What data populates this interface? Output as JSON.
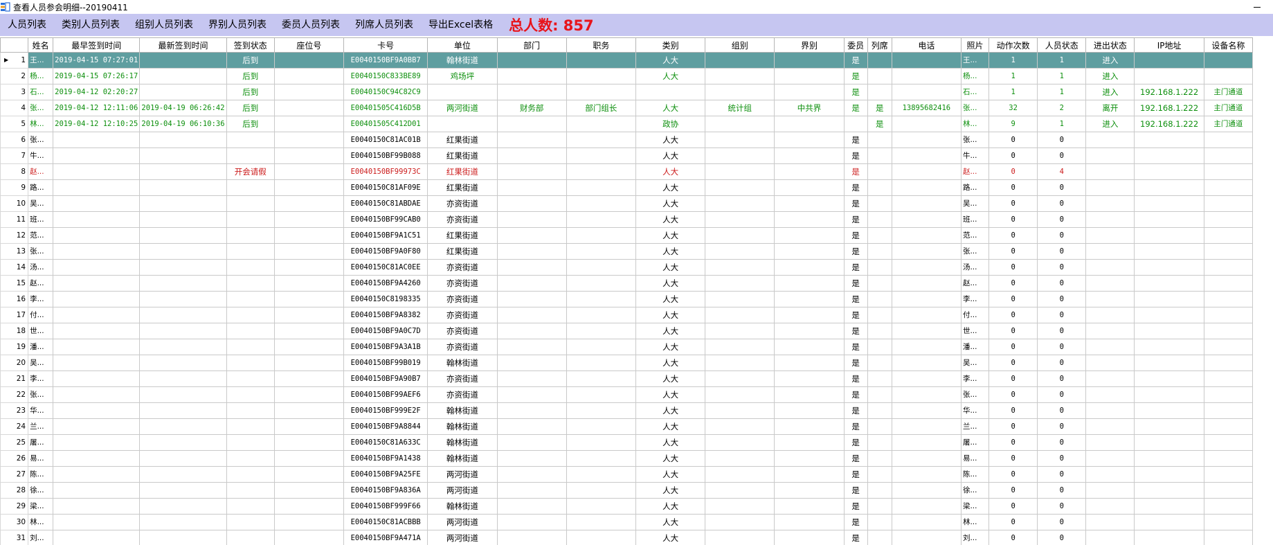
{
  "window": {
    "title": "查看人员参会明细--20190411",
    "app_icon": "app-icon",
    "minimize_label": "–"
  },
  "menu": {
    "items": [
      "人员列表",
      "类别人员列表",
      "组别人员列表",
      "界别人员列表",
      "委员人员列表",
      "列席人员列表",
      "导出Excel表格"
    ],
    "total_label": "总人数: 857"
  },
  "colors": {
    "menubar": "#c6c6f1",
    "selected_row": "#5f9ea0",
    "green_text": "#0d8f0d",
    "red_text": "#cc1c1c",
    "total_text": "#e8141b"
  },
  "columns": [
    "姓名",
    "最早签到时间",
    "最新签到时间",
    "签到状态",
    "座位号",
    "卡号",
    "单位",
    "部门",
    "职务",
    "类别",
    "组别",
    "界别",
    "委员",
    "列席",
    "电话",
    "照片",
    "动作次数",
    "人员状态",
    "进出状态",
    "IP地址",
    "设备名称"
  ],
  "rows": [
    {
      "n": "1",
      "style": "sel",
      "c": [
        "王...",
        "2019-04-15 07:27:01",
        "",
        "后到",
        "",
        "E0040150BF9A0BB7",
        "翰林街道",
        "",
        "",
        "人大",
        "",
        "",
        "是",
        "",
        "",
        "王...",
        "1",
        "1",
        "进入",
        "",
        ""
      ]
    },
    {
      "n": "2",
      "style": "green",
      "c": [
        "杨...",
        "2019-04-15 07:26:17",
        "",
        "后到",
        "",
        "E0040150C833BE89",
        "鸡场坪",
        "",
        "",
        "人大",
        "",
        "",
        "是",
        "",
        "",
        "杨...",
        "1",
        "1",
        "进入",
        "",
        ""
      ]
    },
    {
      "n": "3",
      "style": "green",
      "c": [
        "石...",
        "2019-04-12 02:20:27",
        "",
        "后到",
        "",
        "E0040150C94C82C9",
        "",
        "",
        "",
        "",
        "",
        "",
        "是",
        "",
        "",
        "石...",
        "1",
        "1",
        "进入",
        "192.168.1.222",
        "主门通道"
      ]
    },
    {
      "n": "4",
      "style": "green",
      "c": [
        "张...",
        "2019-04-12 12:11:06",
        "2019-04-19 06:26:42",
        "后到",
        "",
        "E00401505C416D5B",
        "两河街道",
        "财务部",
        "部门组长",
        "人大",
        "统计组",
        "中共界",
        "是",
        "是",
        "13895682416",
        "张...",
        "32",
        "2",
        "离开",
        "192.168.1.222",
        "主门通道"
      ]
    },
    {
      "n": "5",
      "style": "green",
      "c": [
        "林...",
        "2019-04-12 12:10:25",
        "2019-04-19 06:10:36",
        "后到",
        "",
        "E00401505C412D01",
        "",
        "",
        "",
        "政协",
        "",
        "",
        "",
        "是",
        "",
        "林...",
        "9",
        "1",
        "进入",
        "192.168.1.222",
        "主门通道"
      ]
    },
    {
      "n": "6",
      "style": "",
      "c": [
        "张...",
        "",
        "",
        "",
        "",
        "E0040150C81AC01B",
        "红果街道",
        "",
        "",
        "人大",
        "",
        "",
        "是",
        "",
        "",
        "张...",
        "0",
        "0",
        "",
        "",
        ""
      ]
    },
    {
      "n": "7",
      "style": "",
      "c": [
        "牛...",
        "",
        "",
        "",
        "",
        "E0040150BF99B088",
        "红果街道",
        "",
        "",
        "人大",
        "",
        "",
        "是",
        "",
        "",
        "牛...",
        "0",
        "0",
        "",
        "",
        ""
      ]
    },
    {
      "n": "8",
      "style": "red",
      "c": [
        "赵...",
        "",
        "",
        "开会请假",
        "",
        "E0040150BF99973C",
        "红果街道",
        "",
        "",
        "人大",
        "",
        "",
        "是",
        "",
        "",
        "赵...",
        "0",
        "4",
        "",
        "",
        ""
      ]
    },
    {
      "n": "9",
      "style": "",
      "c": [
        "路...",
        "",
        "",
        "",
        "",
        "E0040150C81AF09E",
        "红果街道",
        "",
        "",
        "人大",
        "",
        "",
        "是",
        "",
        "",
        "路...",
        "0",
        "0",
        "",
        "",
        ""
      ]
    },
    {
      "n": "10",
      "style": "",
      "c": [
        "吴...",
        "",
        "",
        "",
        "",
        "E0040150C81ABDAE",
        "亦资街道",
        "",
        "",
        "人大",
        "",
        "",
        "是",
        "",
        "",
        "吴...",
        "0",
        "0",
        "",
        "",
        ""
      ]
    },
    {
      "n": "11",
      "style": "",
      "c": [
        "班...",
        "",
        "",
        "",
        "",
        "E0040150BF99CAB0",
        "亦资街道",
        "",
        "",
        "人大",
        "",
        "",
        "是",
        "",
        "",
        "班...",
        "0",
        "0",
        "",
        "",
        ""
      ]
    },
    {
      "n": "12",
      "style": "",
      "c": [
        "范...",
        "",
        "",
        "",
        "",
        "E0040150BF9A1C51",
        "红果街道",
        "",
        "",
        "人大",
        "",
        "",
        "是",
        "",
        "",
        "范...",
        "0",
        "0",
        "",
        "",
        ""
      ]
    },
    {
      "n": "13",
      "style": "",
      "c": [
        "张...",
        "",
        "",
        "",
        "",
        "E0040150BF9A0F80",
        "红果街道",
        "",
        "",
        "人大",
        "",
        "",
        "是",
        "",
        "",
        "张...",
        "0",
        "0",
        "",
        "",
        ""
      ]
    },
    {
      "n": "14",
      "style": "",
      "c": [
        "汤...",
        "",
        "",
        "",
        "",
        "E0040150C81AC0EE",
        "亦资街道",
        "",
        "",
        "人大",
        "",
        "",
        "是",
        "",
        "",
        "汤...",
        "0",
        "0",
        "",
        "",
        ""
      ]
    },
    {
      "n": "15",
      "style": "",
      "c": [
        "赵...",
        "",
        "",
        "",
        "",
        "E0040150BF9A4260",
        "亦资街道",
        "",
        "",
        "人大",
        "",
        "",
        "是",
        "",
        "",
        "赵...",
        "0",
        "0",
        "",
        "",
        ""
      ]
    },
    {
      "n": "16",
      "style": "",
      "c": [
        "李...",
        "",
        "",
        "",
        "",
        "E0040150C8198335",
        "亦资街道",
        "",
        "",
        "人大",
        "",
        "",
        "是",
        "",
        "",
        "李...",
        "0",
        "0",
        "",
        "",
        ""
      ]
    },
    {
      "n": "17",
      "style": "",
      "c": [
        "付...",
        "",
        "",
        "",
        "",
        "E0040150BF9A8382",
        "亦资街道",
        "",
        "",
        "人大",
        "",
        "",
        "是",
        "",
        "",
        "付...",
        "0",
        "0",
        "",
        "",
        ""
      ]
    },
    {
      "n": "18",
      "style": "",
      "c": [
        "世...",
        "",
        "",
        "",
        "",
        "E0040150BF9A0C7D",
        "亦资街道",
        "",
        "",
        "人大",
        "",
        "",
        "是",
        "",
        "",
        "世...",
        "0",
        "0",
        "",
        "",
        ""
      ]
    },
    {
      "n": "19",
      "style": "",
      "c": [
        "潘...",
        "",
        "",
        "",
        "",
        "E0040150BF9A3A1B",
        "亦资街道",
        "",
        "",
        "人大",
        "",
        "",
        "是",
        "",
        "",
        "潘...",
        "0",
        "0",
        "",
        "",
        ""
      ]
    },
    {
      "n": "20",
      "style": "",
      "c": [
        "吴...",
        "",
        "",
        "",
        "",
        "E0040150BF99B019",
        "翰林街道",
        "",
        "",
        "人大",
        "",
        "",
        "是",
        "",
        "",
        "吴...",
        "0",
        "0",
        "",
        "",
        ""
      ]
    },
    {
      "n": "21",
      "style": "",
      "c": [
        "李...",
        "",
        "",
        "",
        "",
        "E0040150BF9A90B7",
        "亦资街道",
        "",
        "",
        "人大",
        "",
        "",
        "是",
        "",
        "",
        "李...",
        "0",
        "0",
        "",
        "",
        ""
      ]
    },
    {
      "n": "22",
      "style": "",
      "c": [
        "张...",
        "",
        "",
        "",
        "",
        "E0040150BF99AEF6",
        "亦资街道",
        "",
        "",
        "人大",
        "",
        "",
        "是",
        "",
        "",
        "张...",
        "0",
        "0",
        "",
        "",
        ""
      ]
    },
    {
      "n": "23",
      "style": "",
      "c": [
        "华...",
        "",
        "",
        "",
        "",
        "E0040150BF999E2F",
        "翰林街道",
        "",
        "",
        "人大",
        "",
        "",
        "是",
        "",
        "",
        "华...",
        "0",
        "0",
        "",
        "",
        ""
      ]
    },
    {
      "n": "24",
      "style": "",
      "c": [
        "兰...",
        "",
        "",
        "",
        "",
        "E0040150BF9A8844",
        "翰林街道",
        "",
        "",
        "人大",
        "",
        "",
        "是",
        "",
        "",
        "兰...",
        "0",
        "0",
        "",
        "",
        ""
      ]
    },
    {
      "n": "25",
      "style": "",
      "c": [
        "屠...",
        "",
        "",
        "",
        "",
        "E0040150C81A633C",
        "翰林街道",
        "",
        "",
        "人大",
        "",
        "",
        "是",
        "",
        "",
        "屠...",
        "0",
        "0",
        "",
        "",
        ""
      ]
    },
    {
      "n": "26",
      "style": "",
      "c": [
        "易...",
        "",
        "",
        "",
        "",
        "E0040150BF9A1438",
        "翰林街道",
        "",
        "",
        "人大",
        "",
        "",
        "是",
        "",
        "",
        "易...",
        "0",
        "0",
        "",
        "",
        ""
      ]
    },
    {
      "n": "27",
      "style": "",
      "c": [
        "陈...",
        "",
        "",
        "",
        "",
        "E0040150BF9A25FE",
        "两河街道",
        "",
        "",
        "人大",
        "",
        "",
        "是",
        "",
        "",
        "陈...",
        "0",
        "0",
        "",
        "",
        ""
      ]
    },
    {
      "n": "28",
      "style": "",
      "c": [
        "徐...",
        "",
        "",
        "",
        "",
        "E0040150BF9A836A",
        "两河街道",
        "",
        "",
        "人大",
        "",
        "",
        "是",
        "",
        "",
        "徐...",
        "0",
        "0",
        "",
        "",
        ""
      ]
    },
    {
      "n": "29",
      "style": "",
      "c": [
        "梁...",
        "",
        "",
        "",
        "",
        "E0040150BF999F66",
        "翰林街道",
        "",
        "",
        "人大",
        "",
        "",
        "是",
        "",
        "",
        "梁...",
        "0",
        "0",
        "",
        "",
        ""
      ]
    },
    {
      "n": "30",
      "style": "",
      "c": [
        "林...",
        "",
        "",
        "",
        "",
        "E0040150C81ACBBB",
        "两河街道",
        "",
        "",
        "人大",
        "",
        "",
        "是",
        "",
        "",
        "林...",
        "0",
        "0",
        "",
        "",
        ""
      ]
    },
    {
      "n": "31",
      "style": "",
      "c": [
        "刘...",
        "",
        "",
        "",
        "",
        "E0040150BF9A471A",
        "两河街道",
        "",
        "",
        "人大",
        "",
        "",
        "是",
        "",
        "",
        "刘...",
        "0",
        "0",
        "",
        "",
        ""
      ]
    }
  ]
}
